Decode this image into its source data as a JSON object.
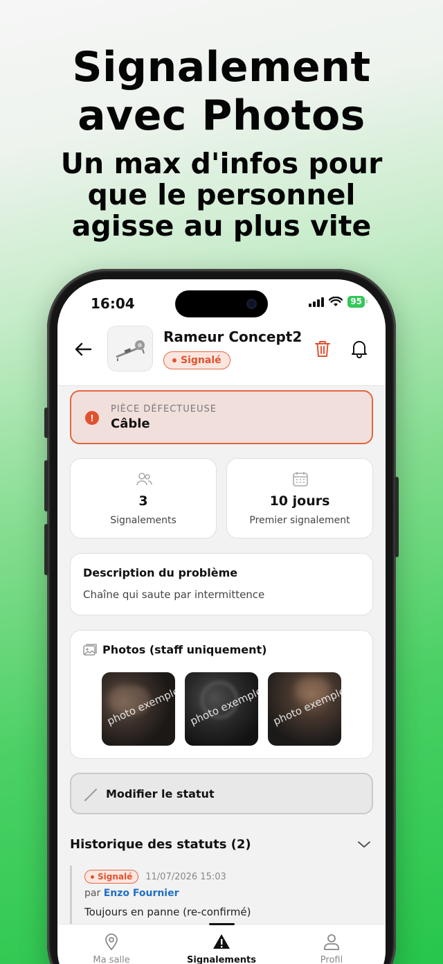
{
  "hero": {
    "title_line1": "Signalement",
    "title_line2": "avec Photos",
    "subtitle_line1": "Un max d'infos pour",
    "subtitle_line2": "que le personnel",
    "subtitle_line3": "agisse au plus vite"
  },
  "status_bar": {
    "time": "16:04",
    "battery": "95"
  },
  "header": {
    "title": "Rameur Concept2",
    "status_badge": "Signalé"
  },
  "defect": {
    "label": "PIÈCE DÉFECTUEUSE",
    "value": "Câble"
  },
  "stats": [
    {
      "value": "3",
      "caption": "Signalements",
      "icon": "users-icon"
    },
    {
      "value": "10 jours",
      "caption": "Premier signalement",
      "icon": "calendar-icon"
    }
  ],
  "description": {
    "heading": "Description du problème",
    "text": "Chaîne qui saute par intermittence"
  },
  "photos": {
    "heading": "Photos (staff uniquement)",
    "items": [
      {
        "watermark": "photo exemple"
      },
      {
        "watermark": "photo exemple"
      },
      {
        "watermark": "photo exemple"
      }
    ]
  },
  "modify_status": {
    "label": "Modifier le statut"
  },
  "history": {
    "heading": "Historique des statuts (2)",
    "entries": [
      {
        "badge": "Signalé",
        "date": "11/07/2026 15:03",
        "by_prefix": "par",
        "author": "Enzo Fournier",
        "note": "Toujours en panne (re-confirmé)"
      }
    ]
  },
  "tabs": [
    {
      "label": "Ma salle",
      "icon": "map-pin-icon"
    },
    {
      "label": "Signalements",
      "icon": "warning-icon"
    },
    {
      "label": "Profil",
      "icon": "user-icon"
    }
  ],
  "colors": {
    "accent_red": "#e0522f",
    "link_blue": "#1f6fc5",
    "battery_green": "#34c759"
  }
}
